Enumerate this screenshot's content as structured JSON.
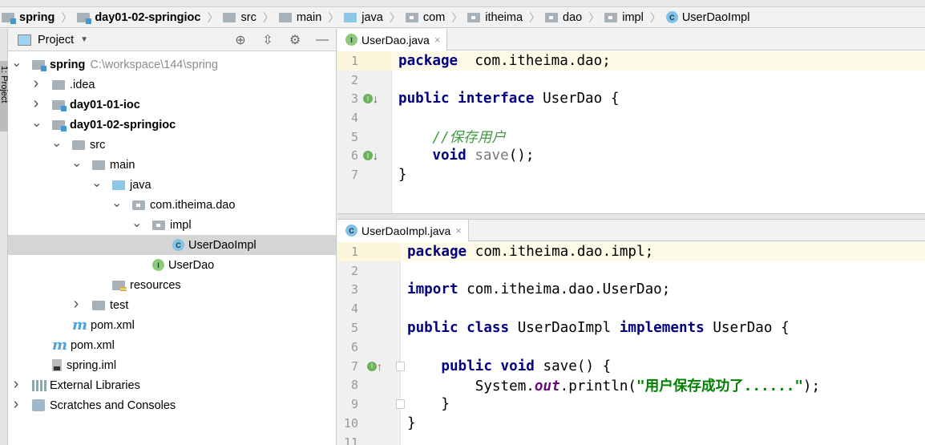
{
  "breadcrumbs": [
    {
      "label": "spring",
      "icon": "module-folder",
      "bold": true
    },
    {
      "label": "day01-02-springioc",
      "icon": "module-folder",
      "bold": true
    },
    {
      "label": "src",
      "icon": "folder"
    },
    {
      "label": "main",
      "icon": "folder"
    },
    {
      "label": "java",
      "icon": "source-folder"
    },
    {
      "label": "com",
      "icon": "package"
    },
    {
      "label": "itheima",
      "icon": "package"
    },
    {
      "label": "dao",
      "icon": "package"
    },
    {
      "label": "impl",
      "icon": "package"
    },
    {
      "label": "UserDaoImpl",
      "icon": "class"
    }
  ],
  "side_stripe": {
    "label": "1: Project"
  },
  "project_panel": {
    "title": "Project",
    "tools": [
      "locate-icon",
      "collapse-icon",
      "gear-icon",
      "minimize-icon"
    ],
    "tree": [
      {
        "label": "spring",
        "hint": "C:\\workspace\\144\\spring",
        "level": 0,
        "arrow": "down",
        "icon": "module",
        "bold": true
      },
      {
        "label": ".idea",
        "level": 1,
        "arrow": "right",
        "icon": "folder"
      },
      {
        "label": "day01-01-ioc",
        "level": 1,
        "arrow": "right",
        "icon": "module",
        "bold": true
      },
      {
        "label": "day01-02-springioc",
        "level": 1,
        "arrow": "down",
        "icon": "module",
        "bold": true
      },
      {
        "label": "src",
        "level": 2,
        "arrow": "down",
        "icon": "folder"
      },
      {
        "label": "main",
        "level": 3,
        "arrow": "down",
        "icon": "folder"
      },
      {
        "label": "java",
        "level": 4,
        "arrow": "down",
        "icon": "source-folder"
      },
      {
        "label": "com.itheima.dao",
        "level": 5,
        "arrow": "down",
        "icon": "package"
      },
      {
        "label": "impl",
        "level": 6,
        "arrow": "down",
        "icon": "package"
      },
      {
        "label": "UserDaoImpl",
        "level": 7,
        "arrow": "",
        "icon": "class",
        "selected": true
      },
      {
        "label": "UserDao",
        "level": 6,
        "arrow": "",
        "icon": "interface"
      },
      {
        "label": "resources",
        "level": 4,
        "arrow": "",
        "icon": "resources"
      },
      {
        "label": "test",
        "level": 3,
        "arrow": "right",
        "icon": "folder"
      },
      {
        "label": "pom.xml",
        "level": 2,
        "arrow": "",
        "icon": "maven"
      },
      {
        "label": "pom.xml",
        "level": 1,
        "arrow": "",
        "icon": "maven"
      },
      {
        "label": "spring.iml",
        "level": 1,
        "arrow": "",
        "icon": "iml"
      },
      {
        "label": "External Libraries",
        "level": 0,
        "arrow": "right",
        "icon": "libraries"
      },
      {
        "label": "Scratches and Consoles",
        "level": 0,
        "arrow": "right",
        "icon": "scratches"
      }
    ]
  },
  "editor_top": {
    "tab": {
      "label": "UserDao.java",
      "icon": "interface",
      "close": "×"
    },
    "lines": [
      {
        "n": "1",
        "tokens": [
          [
            "k",
            "package"
          ],
          [
            "",
            "  com.itheima.dao;"
          ]
        ]
      },
      {
        "n": "2",
        "tokens": []
      },
      {
        "n": "3",
        "tokens": [
          [
            "k",
            "public interface"
          ],
          [
            "",
            " UserDao {"
          ]
        ],
        "marker": "implemented-down"
      },
      {
        "n": "4",
        "tokens": []
      },
      {
        "n": "5",
        "tokens": [
          [
            "",
            "    "
          ],
          [
            "cm",
            "//保存用户"
          ]
        ]
      },
      {
        "n": "6",
        "tokens": [
          [
            "",
            "    "
          ],
          [
            "k",
            "void"
          ],
          [
            "",
            " "
          ],
          [
            "mth",
            "save"
          ],
          [
            "",
            "();"
          ]
        ],
        "marker": "implemented-down"
      },
      {
        "n": "7",
        "tokens": [
          [
            "",
            "}"
          ]
        ]
      }
    ]
  },
  "editor_bottom": {
    "tab": {
      "label": "UserDaoImpl.java",
      "icon": "class",
      "close": "×"
    },
    "lines": [
      {
        "n": "1",
        "tokens": [
          [
            "k",
            "package"
          ],
          [
            "",
            " com.itheima.dao.impl;"
          ]
        ]
      },
      {
        "n": "2",
        "tokens": []
      },
      {
        "n": "3",
        "tokens": [
          [
            "k",
            "import"
          ],
          [
            "",
            " com.itheima.dao.UserDao;"
          ]
        ]
      },
      {
        "n": "4",
        "tokens": []
      },
      {
        "n": "5",
        "tokens": [
          [
            "k",
            "public class"
          ],
          [
            "",
            " UserDaoImpl "
          ],
          [
            "k",
            "implements"
          ],
          [
            "",
            " UserDao {"
          ]
        ]
      },
      {
        "n": "6",
        "tokens": []
      },
      {
        "n": "7",
        "tokens": [
          [
            "",
            "    "
          ],
          [
            "k",
            "public void"
          ],
          [
            "",
            " save() {"
          ]
        ],
        "marker": "implements-up",
        "fold": true
      },
      {
        "n": "8",
        "tokens": [
          [
            "",
            "        System."
          ],
          [
            "fld",
            "out"
          ],
          [
            "",
            ".println("
          ],
          [
            "str",
            "\"用户保存成功了......\""
          ],
          [
            "",
            ");"
          ]
        ]
      },
      {
        "n": "9",
        "tokens": [
          [
            "",
            "    }"
          ]
        ],
        "fold": true
      },
      {
        "n": "10",
        "tokens": [
          [
            "",
            "}"
          ]
        ]
      },
      {
        "n": "11",
        "tokens": []
      }
    ]
  }
}
